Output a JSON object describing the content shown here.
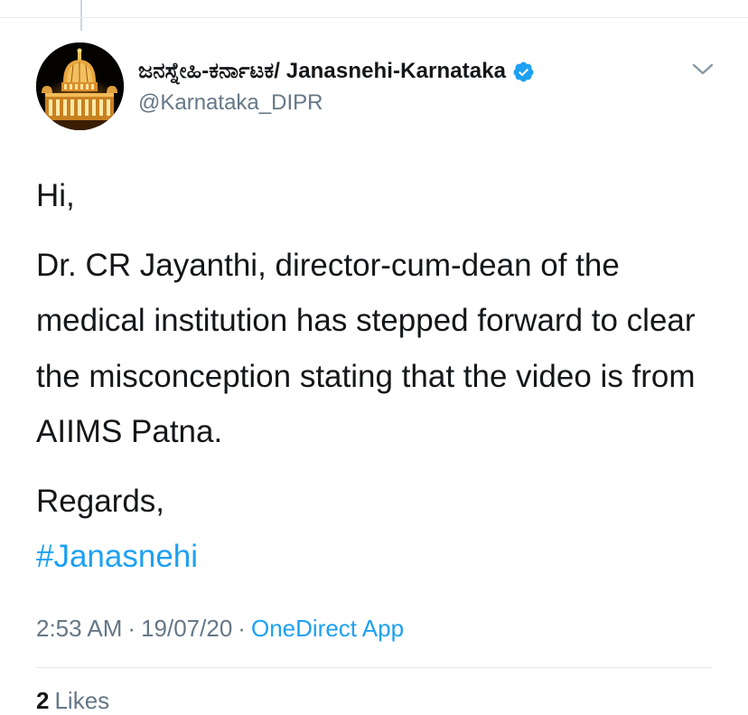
{
  "tweet": {
    "display_name": "ಜನಸ್ನೇಹಿ-ಕರ್ನಾಟಕ/ Janasnehi-Karnataka",
    "handle": "@Karnataka_DIPR",
    "verified": true,
    "avatar_icon": "vidhana-soudha-avatar",
    "menu_icon": "chevron-down-icon",
    "body": {
      "greeting": "Hi,",
      "main_text": "Dr. CR Jayanthi, director-cum-dean of the medical institution has stepped forward to clear the misconception stating that the video is from AIIMS Patna.",
      "closing": "Regards,",
      "hashtag": "#Janasnehi"
    },
    "meta": {
      "time": "2:53 AM",
      "separator": "·",
      "date": "19/07/20",
      "source": "OneDirect App"
    },
    "stats": {
      "likes_count": "2",
      "likes_label": "Likes"
    }
  },
  "colors": {
    "text_primary": "#14171a",
    "text_secondary": "#657786",
    "accent": "#1da1f2",
    "divider": "#e1e8ed"
  }
}
